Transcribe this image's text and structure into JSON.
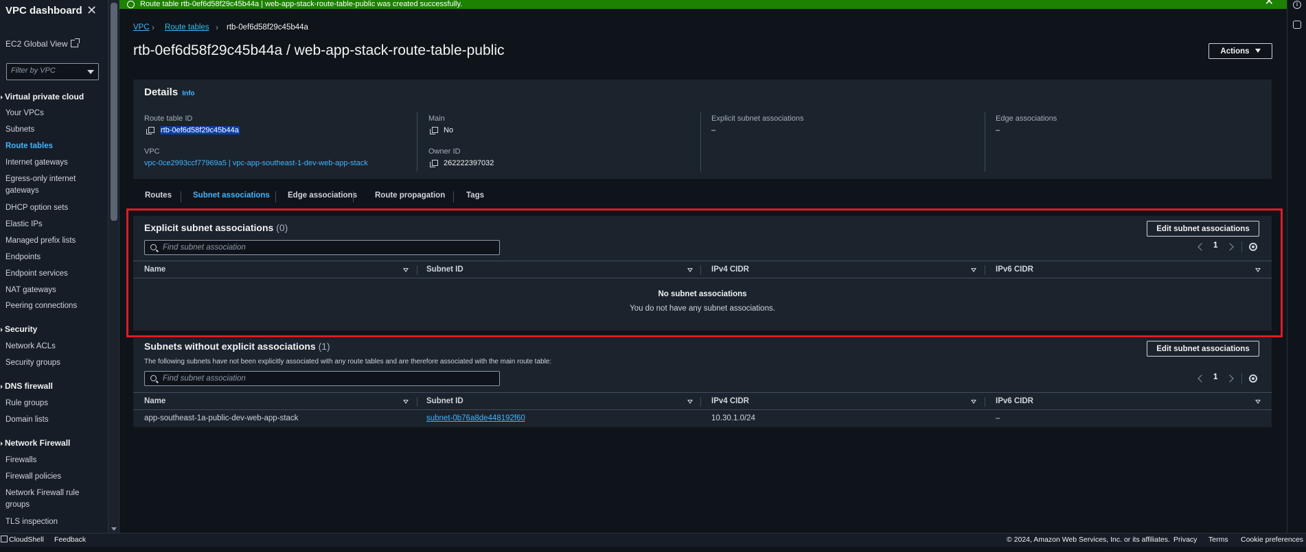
{
  "flash": {
    "message": "Route table rtb-0ef6d58f29c45b44a | web-app-stack-route-table-public was created successfully."
  },
  "sidebar": {
    "title": "VPC dashboard",
    "global_view": "EC2 Global View",
    "filter_placeholder": "Filter by VPC",
    "sections": [
      {
        "title": "Virtual private cloud",
        "items": [
          "Your VPCs",
          "Subnets",
          "Route tables",
          "Internet gateways",
          "Egress-only internet gateways",
          "DHCP option sets",
          "Elastic IPs",
          "Managed prefix lists",
          "Endpoints",
          "Endpoint services",
          "NAT gateways",
          "Peering connections"
        ]
      },
      {
        "title": "Security",
        "items": [
          "Network ACLs",
          "Security groups"
        ]
      },
      {
        "title": "DNS firewall",
        "items": [
          "Rule groups",
          "Domain lists"
        ]
      },
      {
        "title": "Network Firewall",
        "items": [
          "Firewalls",
          "Firewall policies",
          "Network Firewall rule groups",
          "TLS inspection"
        ]
      }
    ],
    "active_item": "Route tables"
  },
  "breadcrumb": {
    "vpc": "VPC",
    "route_tables": "Route tables",
    "current": "rtb-0ef6d58f29c45b44a"
  },
  "page": {
    "title": "rtb-0ef6d58f29c45b44a / web-app-stack-route-table-public",
    "actions_label": "Actions"
  },
  "details": {
    "heading": "Details",
    "info": "Info",
    "route_table_id_label": "Route table ID",
    "route_table_id": "rtb-0ef6d58f29c45b44a",
    "vpc_label": "VPC",
    "vpc_value": "vpc-0ce2993ccf77969a5 | vpc-app-southeast-1-dev-web-app-stack",
    "main_label": "Main",
    "main_value": "No",
    "owner_label": "Owner ID",
    "owner_value": "262222397032",
    "explicit_label": "Explicit subnet associations",
    "explicit_value": "–",
    "edge_label": "Edge associations",
    "edge_value": "–"
  },
  "tabs": [
    "Routes",
    "Subnet associations",
    "Edge associations",
    "Route propagation",
    "Tags"
  ],
  "active_tab": "Subnet associations",
  "explicit": {
    "title": "Explicit subnet associations",
    "count": "(0)",
    "edit_label": "Edit subnet associations",
    "search_placeholder": "Find subnet association",
    "page": "1",
    "columns": [
      "Name",
      "Subnet ID",
      "IPv4 CIDR",
      "IPv6 CIDR"
    ],
    "empty_title": "No subnet associations",
    "empty_sub": "You do not have any subnet associations."
  },
  "implicit": {
    "title": "Subnets without explicit associations",
    "count": "(1)",
    "description": "The following subnets have not been explicitly associated with any route tables and are therefore associated with the main route table:",
    "edit_label": "Edit subnet associations",
    "search_placeholder": "Find subnet association",
    "page": "1",
    "columns": [
      "Name",
      "Subnet ID",
      "IPv4 CIDR",
      "IPv6 CIDR"
    ],
    "rows": [
      {
        "name": "app-southeast-1a-public-dev-web-app-stack",
        "subnet_id": "subnet-0b76a8de448192f60",
        "ipv4": "10.30.1.0/24",
        "ipv6": "–"
      }
    ]
  },
  "footer": {
    "cloudshell": "CloudShell",
    "feedback": "Feedback",
    "copyright": "© 2024, Amazon Web Services, Inc. or its affiliates.",
    "privacy": "Privacy",
    "terms": "Terms",
    "cookies": "Cookie preferences"
  },
  "colors": {
    "accent": "#42b4ff",
    "success": "#1d8102",
    "highlight_box": "#e21a23",
    "background": "#0f141a",
    "panel": "#1b232d"
  },
  "icons": [
    "close-icon",
    "external-link-icon",
    "caret-down-icon",
    "check-circle-icon",
    "copy-icon",
    "search-icon",
    "chevron-left-icon",
    "chevron-right-icon",
    "gear-icon",
    "info-icon",
    "cloudshell-icon"
  ]
}
